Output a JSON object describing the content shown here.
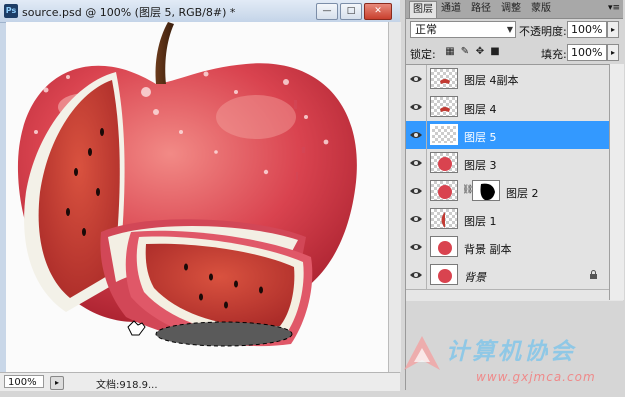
{
  "document": {
    "title": "source.psd @ 100% (图层 5, RGB/8#) *",
    "app_badge": "Ps",
    "window_buttons": [
      "—",
      "□",
      "✕"
    ],
    "zoom": "100%",
    "info": "文档:918.9..."
  },
  "panel": {
    "tabs": [
      "图层",
      "通道",
      "路径",
      "调整",
      "蒙版"
    ],
    "active_tab": "图层",
    "blend_mode": "正常",
    "opacity_label": "不透明度:",
    "opacity": "100%",
    "lock_label": "锁定:",
    "fill_label": "填充:",
    "fill": "100%"
  },
  "layers": [
    {
      "name": "图层 4副本",
      "selected": false,
      "thumb": "slice-small"
    },
    {
      "name": "图层 4",
      "selected": false,
      "thumb": "slice-small"
    },
    {
      "name": "图层 5",
      "selected": true,
      "thumb": "empty"
    },
    {
      "name": "图层 3",
      "selected": false,
      "thumb": "apple"
    },
    {
      "name": "图层 2",
      "selected": false,
      "thumb": "apple",
      "mask": true
    },
    {
      "name": "图层 1",
      "selected": false,
      "thumb": "half"
    },
    {
      "name": "背景 副本",
      "selected": false,
      "thumb": "apple"
    },
    {
      "name": "背景",
      "selected": false,
      "thumb": "apple",
      "italic": true,
      "locked": true
    }
  ],
  "watermark": {
    "text": "计算机协会",
    "url": "www.gxjmca.com"
  },
  "colors": {
    "selection": "#3399ff",
    "apple": "#d9434f",
    "watermelon": "#c23a32"
  }
}
